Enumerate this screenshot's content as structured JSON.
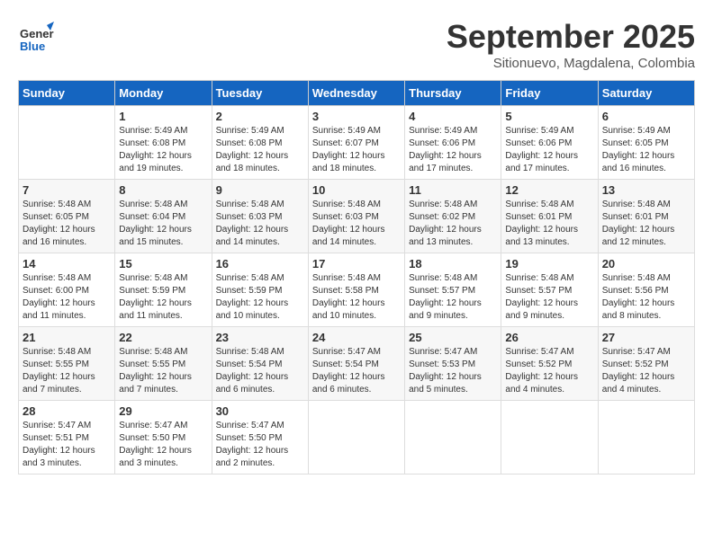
{
  "header": {
    "logo_line1": "General",
    "logo_line2": "Blue",
    "month": "September 2025",
    "location": "Sitionuevo, Magdalena, Colombia"
  },
  "weekdays": [
    "Sunday",
    "Monday",
    "Tuesday",
    "Wednesday",
    "Thursday",
    "Friday",
    "Saturday"
  ],
  "weeks": [
    [
      {
        "day": "",
        "info": ""
      },
      {
        "day": "1",
        "info": "Sunrise: 5:49 AM\nSunset: 6:08 PM\nDaylight: 12 hours\nand 19 minutes."
      },
      {
        "day": "2",
        "info": "Sunrise: 5:49 AM\nSunset: 6:08 PM\nDaylight: 12 hours\nand 18 minutes."
      },
      {
        "day": "3",
        "info": "Sunrise: 5:49 AM\nSunset: 6:07 PM\nDaylight: 12 hours\nand 18 minutes."
      },
      {
        "day": "4",
        "info": "Sunrise: 5:49 AM\nSunset: 6:06 PM\nDaylight: 12 hours\nand 17 minutes."
      },
      {
        "day": "5",
        "info": "Sunrise: 5:49 AM\nSunset: 6:06 PM\nDaylight: 12 hours\nand 17 minutes."
      },
      {
        "day": "6",
        "info": "Sunrise: 5:49 AM\nSunset: 6:05 PM\nDaylight: 12 hours\nand 16 minutes."
      }
    ],
    [
      {
        "day": "7",
        "info": "Sunrise: 5:48 AM\nSunset: 6:05 PM\nDaylight: 12 hours\nand 16 minutes."
      },
      {
        "day": "8",
        "info": "Sunrise: 5:48 AM\nSunset: 6:04 PM\nDaylight: 12 hours\nand 15 minutes."
      },
      {
        "day": "9",
        "info": "Sunrise: 5:48 AM\nSunset: 6:03 PM\nDaylight: 12 hours\nand 14 minutes."
      },
      {
        "day": "10",
        "info": "Sunrise: 5:48 AM\nSunset: 6:03 PM\nDaylight: 12 hours\nand 14 minutes."
      },
      {
        "day": "11",
        "info": "Sunrise: 5:48 AM\nSunset: 6:02 PM\nDaylight: 12 hours\nand 13 minutes."
      },
      {
        "day": "12",
        "info": "Sunrise: 5:48 AM\nSunset: 6:01 PM\nDaylight: 12 hours\nand 13 minutes."
      },
      {
        "day": "13",
        "info": "Sunrise: 5:48 AM\nSunset: 6:01 PM\nDaylight: 12 hours\nand 12 minutes."
      }
    ],
    [
      {
        "day": "14",
        "info": "Sunrise: 5:48 AM\nSunset: 6:00 PM\nDaylight: 12 hours\nand 11 minutes."
      },
      {
        "day": "15",
        "info": "Sunrise: 5:48 AM\nSunset: 5:59 PM\nDaylight: 12 hours\nand 11 minutes."
      },
      {
        "day": "16",
        "info": "Sunrise: 5:48 AM\nSunset: 5:59 PM\nDaylight: 12 hours\nand 10 minutes."
      },
      {
        "day": "17",
        "info": "Sunrise: 5:48 AM\nSunset: 5:58 PM\nDaylight: 12 hours\nand 10 minutes."
      },
      {
        "day": "18",
        "info": "Sunrise: 5:48 AM\nSunset: 5:57 PM\nDaylight: 12 hours\nand 9 minutes."
      },
      {
        "day": "19",
        "info": "Sunrise: 5:48 AM\nSunset: 5:57 PM\nDaylight: 12 hours\nand 9 minutes."
      },
      {
        "day": "20",
        "info": "Sunrise: 5:48 AM\nSunset: 5:56 PM\nDaylight: 12 hours\nand 8 minutes."
      }
    ],
    [
      {
        "day": "21",
        "info": "Sunrise: 5:48 AM\nSunset: 5:55 PM\nDaylight: 12 hours\nand 7 minutes."
      },
      {
        "day": "22",
        "info": "Sunrise: 5:48 AM\nSunset: 5:55 PM\nDaylight: 12 hours\nand 7 minutes."
      },
      {
        "day": "23",
        "info": "Sunrise: 5:48 AM\nSunset: 5:54 PM\nDaylight: 12 hours\nand 6 minutes."
      },
      {
        "day": "24",
        "info": "Sunrise: 5:47 AM\nSunset: 5:54 PM\nDaylight: 12 hours\nand 6 minutes."
      },
      {
        "day": "25",
        "info": "Sunrise: 5:47 AM\nSunset: 5:53 PM\nDaylight: 12 hours\nand 5 minutes."
      },
      {
        "day": "26",
        "info": "Sunrise: 5:47 AM\nSunset: 5:52 PM\nDaylight: 12 hours\nand 4 minutes."
      },
      {
        "day": "27",
        "info": "Sunrise: 5:47 AM\nSunset: 5:52 PM\nDaylight: 12 hours\nand 4 minutes."
      }
    ],
    [
      {
        "day": "28",
        "info": "Sunrise: 5:47 AM\nSunset: 5:51 PM\nDaylight: 12 hours\nand 3 minutes."
      },
      {
        "day": "29",
        "info": "Sunrise: 5:47 AM\nSunset: 5:50 PM\nDaylight: 12 hours\nand 3 minutes."
      },
      {
        "day": "30",
        "info": "Sunrise: 5:47 AM\nSunset: 5:50 PM\nDaylight: 12 hours\nand 2 minutes."
      },
      {
        "day": "",
        "info": ""
      },
      {
        "day": "",
        "info": ""
      },
      {
        "day": "",
        "info": ""
      },
      {
        "day": "",
        "info": ""
      }
    ]
  ]
}
